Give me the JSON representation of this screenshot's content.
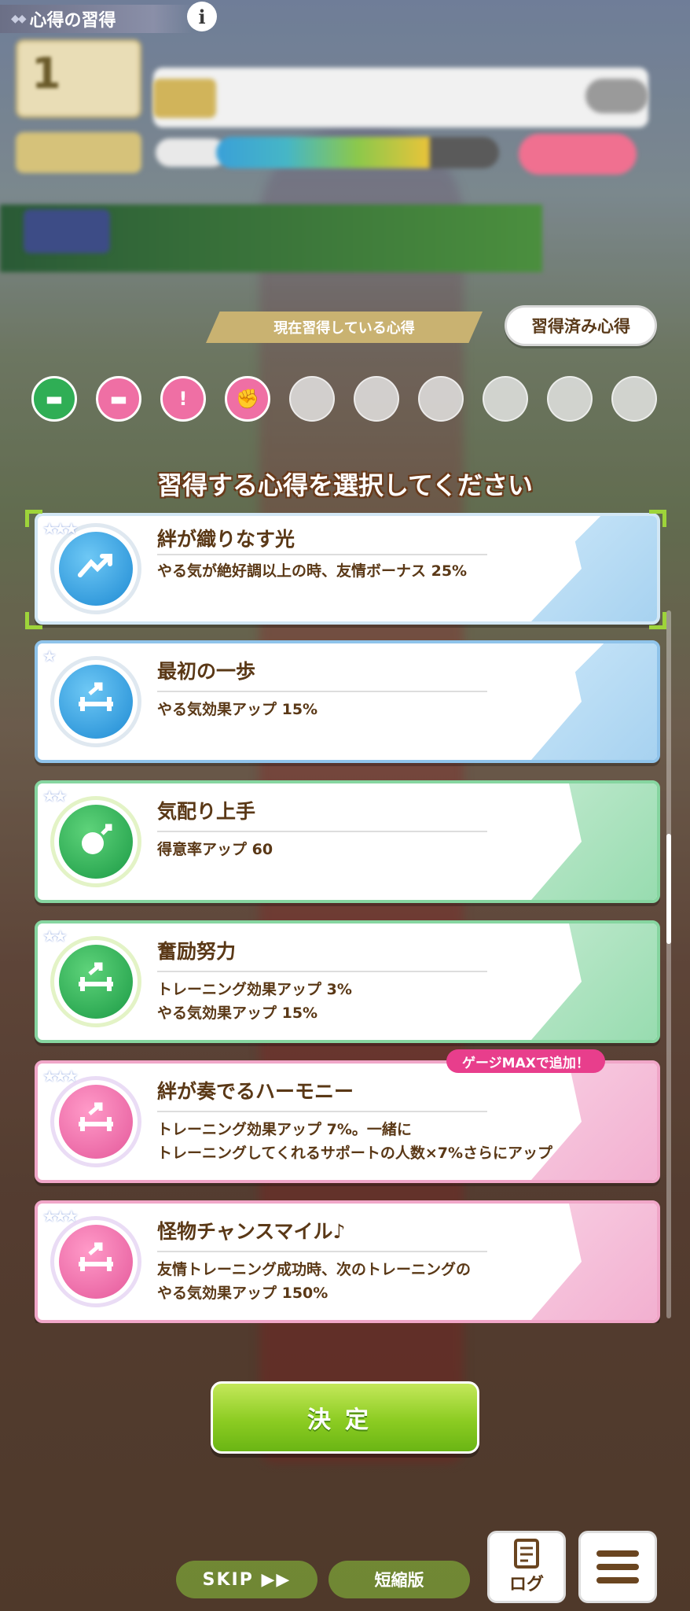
{
  "header": {
    "title": "心得の習得",
    "info_label": "i"
  },
  "status_blur": {
    "turn_number": "1"
  },
  "current": {
    "tag": "現在習得している心得",
    "learned_button": "習得済み心得",
    "slots": [
      {
        "icon": "motivation-pill-icon",
        "color": "#2fae55"
      },
      {
        "icon": "energy-pill-icon",
        "color": "#ef6fa4"
      },
      {
        "icon": "alert-icon",
        "color": "#ef6fa4"
      },
      {
        "icon": "handshake-icon",
        "color": "#ef6fa4"
      }
    ],
    "empty_slots": 6
  },
  "prompt": "習得する心得を選択してください",
  "skills": [
    {
      "title": "絆が織りなす光",
      "desc": [
        "やる気が絶好調以上の時、友情ボーナス 25%"
      ],
      "color": "blue",
      "icon": "handshake-icon",
      "selected": true
    },
    {
      "title": "最初の一歩",
      "desc": [
        "やる気効果アップ 15%"
      ],
      "color": "blue",
      "icon": "dumbbell-up-icon"
    },
    {
      "title": "気配り上手",
      "desc": [
        "得意率アップ 60"
      ],
      "color": "green",
      "icon": "smile-up-icon"
    },
    {
      "title": "奮励努力",
      "desc": [
        "トレーニング効果アップ 3%",
        "やる気効果アップ 15%"
      ],
      "color": "green",
      "icon": "dumbbell-up-icon"
    },
    {
      "title": "絆が奏でるハーモニー",
      "desc": [
        "トレーニング効果アップ 7%。一緒に",
        "トレーニングしてくれるサポートの人数×7%さらにアップ"
      ],
      "color": "pink",
      "icon": "dumbbell-up-icon"
    },
    {
      "title": "怪物チャンスマイル♪",
      "desc": [
        "友情トレーニング成功時、次のトレーニングの",
        "やる気効果アップ 150%"
      ],
      "color": "pink",
      "icon": "dumbbell-up-icon"
    }
  ],
  "gauge_tag": "ゲージMAXで追加！",
  "buttons": {
    "decide": "決定",
    "skip": "SKIP ▶▶",
    "short": "短縮版",
    "log": "ログ"
  }
}
